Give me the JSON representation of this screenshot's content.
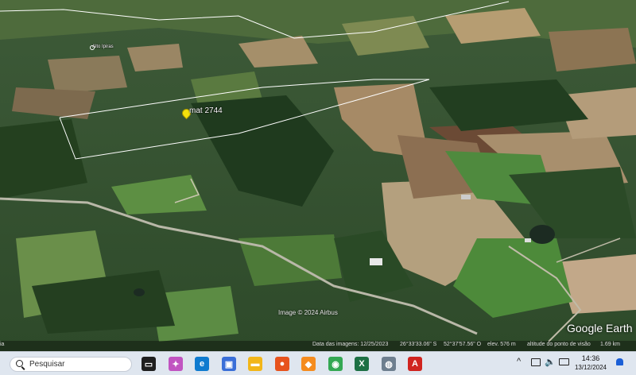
{
  "map": {
    "placemark_label": "mat 2744",
    "small_place_label": "Alto Ipiras",
    "image_credit": "Image © 2024 Airbus",
    "brand": "Google Earth",
    "status": {
      "imagery_date": "Data das imagens: 12/25/2023",
      "lat": "26°33'33.06\" S",
      "lon": "52°37'57.56\" O",
      "elev": "elev.  576 m",
      "eye_alt": "altitude do ponto de visão",
      "eye_alt_value": "1.69 km"
    },
    "left_edge_text": "ia"
  },
  "taskbar": {
    "search_placeholder": "Pesquisar",
    "apps": [
      {
        "name": "task-view-icon",
        "color": "#1f1f1f",
        "glyph": "▭"
      },
      {
        "name": "copilot-icon",
        "color": "#c154c1",
        "glyph": "✦"
      },
      {
        "name": "edge-browser-icon",
        "color": "#0f7bcf",
        "glyph": "e"
      },
      {
        "name": "store-icon",
        "color": "#3a6fd8",
        "glyph": "▣"
      },
      {
        "name": "file-explorer-icon",
        "color": "#f2b619",
        "glyph": "▬"
      },
      {
        "name": "firefox-icon",
        "color": "#e7531d",
        "glyph": "●"
      },
      {
        "name": "app-icon",
        "color": "#f58c1f",
        "glyph": "◆"
      },
      {
        "name": "chrome-icon",
        "color": "#34a853",
        "glyph": "◉"
      },
      {
        "name": "excel-icon",
        "color": "#1d7044",
        "glyph": "X"
      },
      {
        "name": "google-earth-icon",
        "color": "#6e7f8f",
        "glyph": "◍"
      },
      {
        "name": "acrobat-icon",
        "color": "#d0241f",
        "glyph": "A"
      }
    ],
    "tray": {
      "chevron": "^",
      "time": "14:36",
      "date": "13/12/2024"
    }
  }
}
